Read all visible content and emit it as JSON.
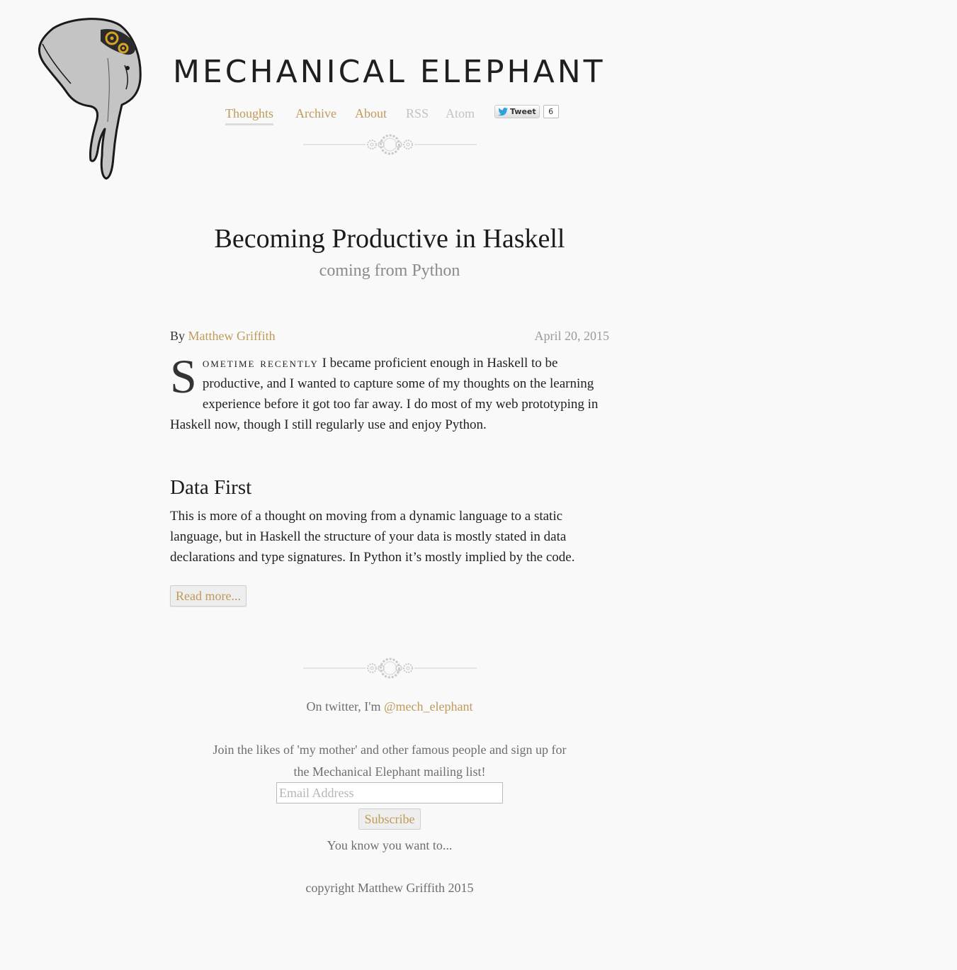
{
  "site": {
    "title": "MECHANICAL ELEPHANT",
    "logo_icon": "elephant-head-with-gears-icon"
  },
  "nav": {
    "items": [
      {
        "label": "Thoughts",
        "state": "active"
      },
      {
        "label": "Archive",
        "state": "link"
      },
      {
        "label": "About",
        "state": "link"
      },
      {
        "label": "RSS",
        "state": "muted"
      },
      {
        "label": "Atom",
        "state": "muted"
      }
    ],
    "tweet": {
      "label": "Tweet",
      "count": "6",
      "icon": "twitter-bird-icon"
    }
  },
  "post": {
    "title": "Becoming Productive in Haskell",
    "subtitle": "coming from Python",
    "byline_prefix": "By",
    "author": "Matthew Griffith",
    "date": "April 20, 2015",
    "intro": {
      "dropcap": "S",
      "smallcaps": "ometime recently",
      "rest": " I became proficient enough in Haskell to be productive, and I wanted to capture some of my thoughts on the learning experience before it got too far away. I do most of my web prototyping in Haskell now, though I still regularly use and enjoy Python."
    },
    "section": {
      "heading": "Data First",
      "body": "This is more of a thought on moving from a dynamic language to a static language, but in Haskell the structure of your data is mostly stated in data declarations and type signatures. In Python it’s mostly implied by the code."
    },
    "read_more": "Read more..."
  },
  "footer": {
    "twitter_prefix": "On twitter, I'm ",
    "twitter_handle": "@mech_elephant",
    "mailing_text": "Join the likes of 'my mother' and other famous people and sign up for the Mechanical Elephant mailing list!",
    "email_placeholder": "Email Address",
    "subscribe_label": "Subscribe",
    "know_text": "You know you want to...",
    "copyright": "copyright Matthew Griffith 2015"
  },
  "colors": {
    "accent": "#bf9a58",
    "muted": "#c3c3c3",
    "background": "#f9f9f9"
  }
}
